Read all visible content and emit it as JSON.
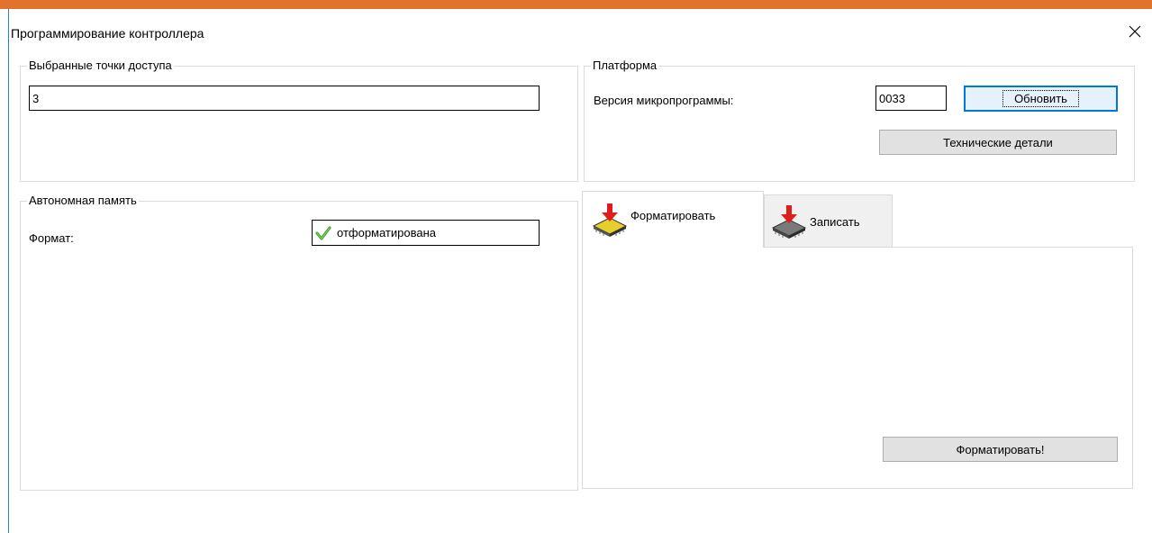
{
  "window": {
    "title": "Программирование контроллера",
    "accent_color": "#e2732a"
  },
  "access_points_group": {
    "legend": "Выбранные точки доступа",
    "value": "3"
  },
  "platform_group": {
    "legend": "Платформа",
    "firmware_label": "Версия микропрограммы:",
    "firmware_value": "0033",
    "refresh_button": "Обновить",
    "tech_details_button": "Технические детали"
  },
  "memory_group": {
    "legend": "Автономная память",
    "format_label": "Формат:",
    "format_status": "отформатирована",
    "format_status_icon": "green-check-icon"
  },
  "tabs": {
    "items": [
      {
        "label": "Форматировать",
        "icon": "chip-format-icon",
        "active": true
      },
      {
        "label": "Записать",
        "icon": "chip-write-icon",
        "active": false
      }
    ],
    "format_button": "Форматировать!"
  }
}
